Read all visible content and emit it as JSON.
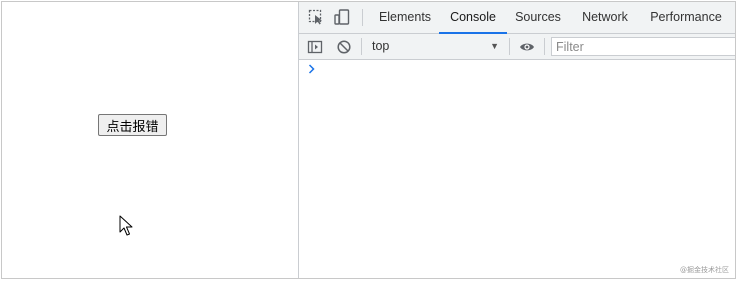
{
  "page": {
    "button_label": "点击报错"
  },
  "devtools": {
    "tabs": [
      {
        "label": "Elements",
        "active": false
      },
      {
        "label": "Console",
        "active": true
      },
      {
        "label": "Sources",
        "active": false
      },
      {
        "label": "Network",
        "active": false
      },
      {
        "label": "Performance",
        "active": false
      }
    ],
    "toolbar": {
      "context_value": "top",
      "filter_placeholder": "Filter"
    },
    "icons": {
      "inspect": "inspect-element-icon",
      "device": "device-toolbar-icon",
      "sidebar": "show-sidebar-icon",
      "clear": "clear-console-icon",
      "context_dropdown": "dropdown-arrow-icon",
      "live_expression": "eye-icon",
      "prompt": "chevron-right-icon"
    },
    "colors": {
      "active_tab_underline": "#1a73e8",
      "toolbar_bg": "#f1f3f4",
      "prompt_chevron": "#1a73e8"
    }
  },
  "watermark": "@掘金技术社区"
}
